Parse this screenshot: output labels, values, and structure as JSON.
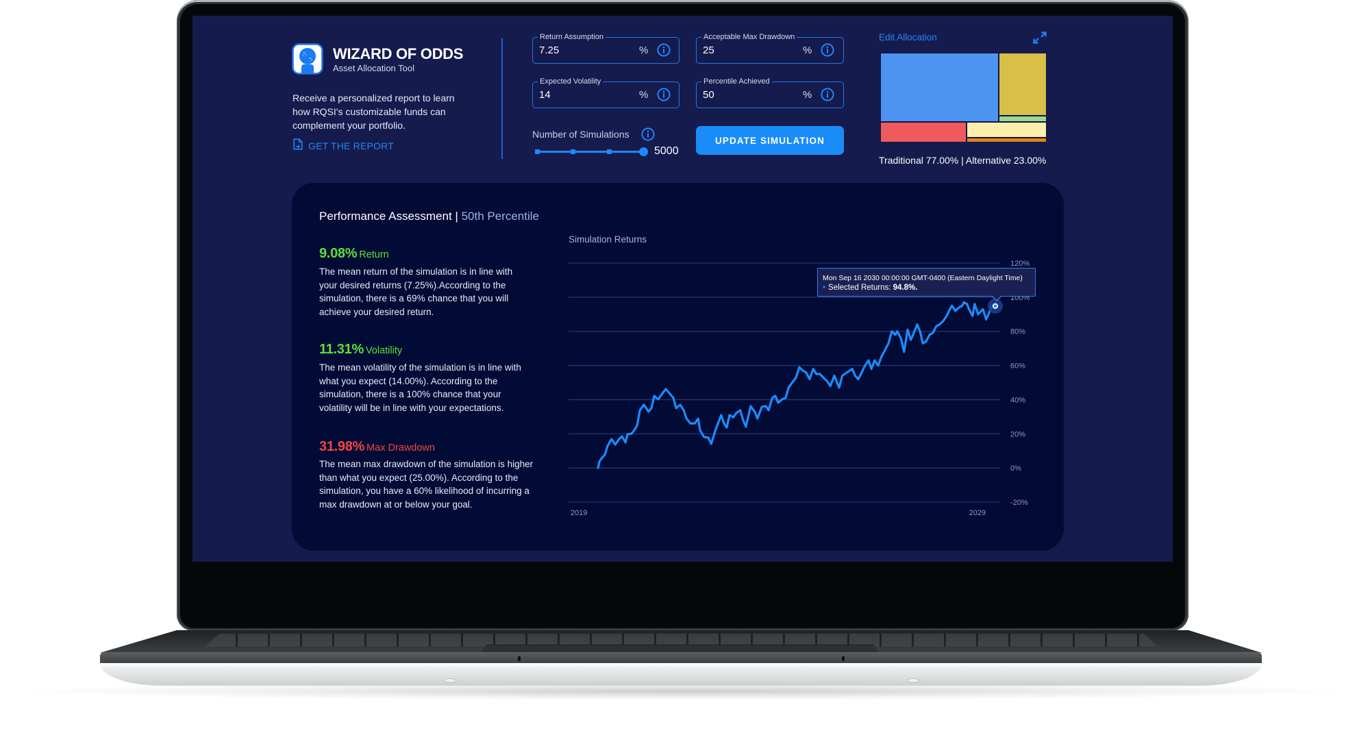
{
  "app": {
    "title": "WIZARD OF ODDS",
    "subtitle": "Asset Allocation Tool",
    "logo_icon": "crystal-ball-icon"
  },
  "intro": {
    "description_lines": [
      "Receive a personalized report to learn",
      "how RQSI's customizable funds can",
      "complement your portfolio."
    ],
    "report_link": "GET THE REPORT",
    "report_icon": "document-icon"
  },
  "inputs": {
    "return_assumption": {
      "label": "Return Assumption",
      "value": "7.25",
      "unit": "%",
      "icon": "info-icon"
    },
    "acceptable_max_drawdown": {
      "label": "Acceptable Max Drawdown",
      "value": "25",
      "unit": "%",
      "icon": "info-icon"
    },
    "expected_volatility": {
      "label": "Expected Volatility",
      "value": "14",
      "unit": "%",
      "icon": "info-icon"
    },
    "percentile_achieved": {
      "label": "Percentile Achieved",
      "value": "50",
      "unit": "%",
      "icon": "info-icon"
    }
  },
  "simulations": {
    "label": "Number of Simulations",
    "value": "5000",
    "slider_fraction": 1.0,
    "slider_steps": 4,
    "icon": "info-icon"
  },
  "update_button": {
    "label": "UPDATE SIMULATION",
    "color": "#1a8cf8"
  },
  "allocation": {
    "edit_link": "Edit Allocation",
    "expand_icon": "expand-icon",
    "summary": "Traditional 77.00% | Alternative 23.00%",
    "groups": [
      {
        "name": "Traditional",
        "weight": 77,
        "cells": [
          {
            "color": "#4d94f2",
            "weight": 54.8
          },
          {
            "color": "#d7bf48",
            "weight": 20.2
          },
          {
            "color": "#98d98e",
            "weight": 2.0
          }
        ]
      },
      {
        "name": "Alternative",
        "weight": 23,
        "cells": [
          {
            "color": "#ef5a5e",
            "weight": 11.9
          },
          {
            "color": "#fdeeaa",
            "weight": 8.5
          },
          {
            "color": "#e0831f",
            "weight": 2.6
          }
        ]
      }
    ]
  },
  "performance": {
    "title": "Performance Assessment",
    "separator": " | ",
    "subtitle": "50th Percentile",
    "metrics": [
      {
        "value": "9.08%",
        "label": "Return",
        "color": "#5ce03a",
        "lines": [
          "The mean return of the simulation is in line with",
          "your desired returns (7.25%).According to the",
          "simulation, there is a 69% chance that you will",
          "achieve your desired return."
        ]
      },
      {
        "value": "11.31%",
        "label": "Volatility",
        "color": "#5ce03a",
        "lines": [
          "The mean volatility of the simulation is in line with",
          "what you expect (14.00%). According to the",
          "simulation, there is a 100% chance that your",
          "volatility will be in line with your expectations."
        ]
      },
      {
        "value": "31.98%",
        "label": "Max Drawdown",
        "color": "#f0473f",
        "lines": [
          "The mean max drawdown of the simulation is higher",
          "than what you expect (25.00%). According to the",
          "simulation, you have a 60% likelihood of incurring a",
          "max drawdown at or below your goal."
        ]
      }
    ]
  },
  "chart_data": {
    "type": "line",
    "title": "Simulation Returns",
    "xlabel": "",
    "ylabel": "",
    "xlim": [
      2018.74,
      2029.57
    ],
    "ylim": [
      -20,
      120
    ],
    "grid": true,
    "legend": "none",
    "x_ticks": [
      {
        "value": 2019,
        "label": "2019"
      },
      {
        "value": 2029,
        "label": "2029"
      }
    ],
    "y_ticks": [
      {
        "value": 120,
        "label": "120%"
      },
      {
        "value": 100,
        "label": "100%"
      },
      {
        "value": 80,
        "label": "80%"
      },
      {
        "value": 60,
        "label": "60%"
      },
      {
        "value": 40,
        "label": "40%"
      },
      {
        "value": 20,
        "label": "20%"
      },
      {
        "value": 0,
        "label": "0%"
      },
      {
        "value": -20,
        "label": "-20%"
      }
    ],
    "series": [
      {
        "name": "Selected Returns",
        "color": "#1a8cff",
        "points": [
          [
            2019.48,
            0
          ],
          [
            2019.52,
            4
          ],
          [
            2019.58,
            6
          ],
          [
            2019.65,
            7.6
          ],
          [
            2019.72,
            12.9
          ],
          [
            2019.82,
            16.9
          ],
          [
            2019.91,
            13.7
          ],
          [
            2020.01,
            16.9
          ],
          [
            2020.08,
            18.5
          ],
          [
            2020.17,
            14.9
          ],
          [
            2020.22,
            19.7
          ],
          [
            2020.32,
            20.1
          ],
          [
            2020.39,
            22.1
          ],
          [
            2020.46,
            24.9
          ],
          [
            2020.53,
            33.8
          ],
          [
            2020.63,
            37
          ],
          [
            2020.75,
            33
          ],
          [
            2020.82,
            35
          ],
          [
            2020.89,
            42.2
          ],
          [
            2020.99,
            40.2
          ],
          [
            2021.1,
            43.8
          ],
          [
            2021.18,
            46.2
          ],
          [
            2021.27,
            43.8
          ],
          [
            2021.37,
            41
          ],
          [
            2021.44,
            35
          ],
          [
            2021.54,
            37
          ],
          [
            2021.63,
            33.8
          ],
          [
            2021.7,
            28.9
          ],
          [
            2021.8,
            26.1
          ],
          [
            2021.91,
            26.1
          ],
          [
            2021.99,
            28.9
          ],
          [
            2022.04,
            22.1
          ],
          [
            2022.14,
            18.1
          ],
          [
            2022.25,
            17.7
          ],
          [
            2022.32,
            14.1
          ],
          [
            2022.42,
            21.7
          ],
          [
            2022.57,
            31
          ],
          [
            2022.64,
            26.1
          ],
          [
            2022.71,
            23.7
          ],
          [
            2022.78,
            31
          ],
          [
            2022.88,
            29.7
          ],
          [
            2022.95,
            32.2
          ],
          [
            2023.05,
            33.8
          ],
          [
            2023.12,
            28.1
          ],
          [
            2023.19,
            24.1
          ],
          [
            2023.31,
            36.2
          ],
          [
            2023.41,
            33
          ],
          [
            2023.48,
            28.9
          ],
          [
            2023.59,
            35.8
          ],
          [
            2023.69,
            36.2
          ],
          [
            2023.76,
            33.8
          ],
          [
            2023.85,
            41
          ],
          [
            2023.93,
            42.2
          ],
          [
            2024.0,
            38.2
          ],
          [
            2024.1,
            40.2
          ],
          [
            2024.19,
            41
          ],
          [
            2024.26,
            47
          ],
          [
            2024.36,
            50.2
          ],
          [
            2024.45,
            53
          ],
          [
            2024.53,
            59
          ],
          [
            2024.62,
            57
          ],
          [
            2024.7,
            56
          ],
          [
            2024.79,
            52
          ],
          [
            2024.88,
            58
          ],
          [
            2024.96,
            55
          ],
          [
            2025.05,
            55
          ],
          [
            2025.13,
            53
          ],
          [
            2025.22,
            51
          ],
          [
            2025.31,
            48
          ],
          [
            2025.41,
            54
          ],
          [
            2025.53,
            47
          ],
          [
            2025.61,
            54
          ],
          [
            2025.73,
            56
          ],
          [
            2025.86,
            58
          ],
          [
            2025.93,
            54
          ],
          [
            2026.01,
            52
          ],
          [
            2026.1,
            56
          ],
          [
            2026.18,
            60
          ],
          [
            2026.27,
            63
          ],
          [
            2026.34,
            58
          ],
          [
            2026.42,
            63
          ],
          [
            2026.51,
            60
          ],
          [
            2026.59,
            65
          ],
          [
            2026.68,
            69
          ],
          [
            2026.77,
            73
          ],
          [
            2026.85,
            80
          ],
          [
            2026.94,
            78
          ],
          [
            2026.99,
            80
          ],
          [
            2027.08,
            76
          ],
          [
            2027.16,
            68
          ],
          [
            2027.25,
            81
          ],
          [
            2027.33,
            75
          ],
          [
            2027.42,
            80
          ],
          [
            2027.49,
            84
          ],
          [
            2027.56,
            80
          ],
          [
            2027.63,
            73
          ],
          [
            2027.71,
            74
          ],
          [
            2027.8,
            78
          ],
          [
            2027.88,
            79
          ],
          [
            2027.97,
            83
          ],
          [
            2028.05,
            84
          ],
          [
            2028.14,
            86
          ],
          [
            2028.23,
            89
          ],
          [
            2028.31,
            93
          ],
          [
            2028.36,
            95
          ],
          [
            2028.45,
            92
          ],
          [
            2028.54,
            94
          ],
          [
            2028.62,
            95
          ],
          [
            2028.66,
            97
          ],
          [
            2028.74,
            96
          ],
          [
            2028.79,
            93
          ],
          [
            2028.88,
            89
          ],
          [
            2028.93,
            96
          ],
          [
            2029.02,
            90
          ],
          [
            2029.14,
            93
          ],
          [
            2029.22,
            87
          ],
          [
            2029.28,
            90
          ],
          [
            2029.36,
            95
          ],
          [
            2029.45,
            94.8
          ]
        ]
      }
    ],
    "hover_point": [
      2029.45,
      94.8
    ],
    "tooltip": {
      "date_text": "Mon Sep 16 2030 00:00:00 GMT-0400 (Eastern Daylight Time)",
      "bullet": "•",
      "label": "Selected Returns: ",
      "value_text": "94.8%."
    }
  }
}
